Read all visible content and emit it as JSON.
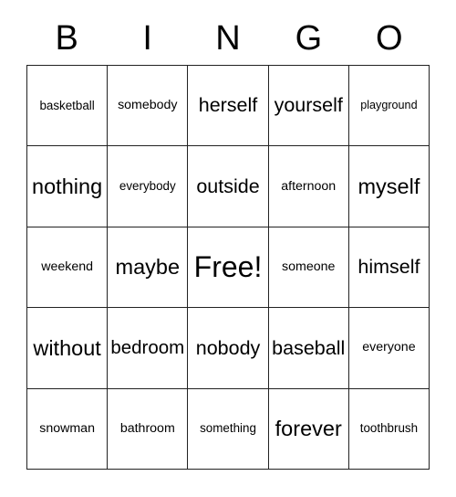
{
  "card": {
    "header": {
      "letters": [
        "B",
        "I",
        "N",
        "G",
        "O"
      ]
    },
    "rows": [
      [
        {
          "text": "basketball",
          "size": "s"
        },
        {
          "text": "somebody",
          "size": "m"
        },
        {
          "text": "herself",
          "size": "l"
        },
        {
          "text": "yourself",
          "size": "l"
        },
        {
          "text": "playground",
          "size": "xs"
        }
      ],
      [
        {
          "text": "nothing",
          "size": "xl"
        },
        {
          "text": "everybody",
          "size": "s"
        },
        {
          "text": "outside",
          "size": "l"
        },
        {
          "text": "afternoon",
          "size": "m"
        },
        {
          "text": "myself",
          "size": "xl"
        }
      ],
      [
        {
          "text": "weekend",
          "size": "m"
        },
        {
          "text": "maybe",
          "size": "xl"
        },
        {
          "text": "Free!",
          "size": "free"
        },
        {
          "text": "someone",
          "size": "m"
        },
        {
          "text": "himself",
          "size": "l"
        }
      ],
      [
        {
          "text": "without",
          "size": "xl"
        },
        {
          "text": "bedroom",
          "size": "l"
        },
        {
          "text": "nobody",
          "size": "l"
        },
        {
          "text": "baseball",
          "size": "l"
        },
        {
          "text": "everyone",
          "size": "m"
        }
      ],
      [
        {
          "text": "snowman",
          "size": "m"
        },
        {
          "text": "bathroom",
          "size": "m"
        },
        {
          "text": "something",
          "size": "s"
        },
        {
          "text": "forever",
          "size": "xl"
        },
        {
          "text": "toothbrush",
          "size": "s"
        }
      ]
    ]
  },
  "colors": {
    "grid_line": "#222222",
    "text": "#000000",
    "background": "#ffffff"
  }
}
